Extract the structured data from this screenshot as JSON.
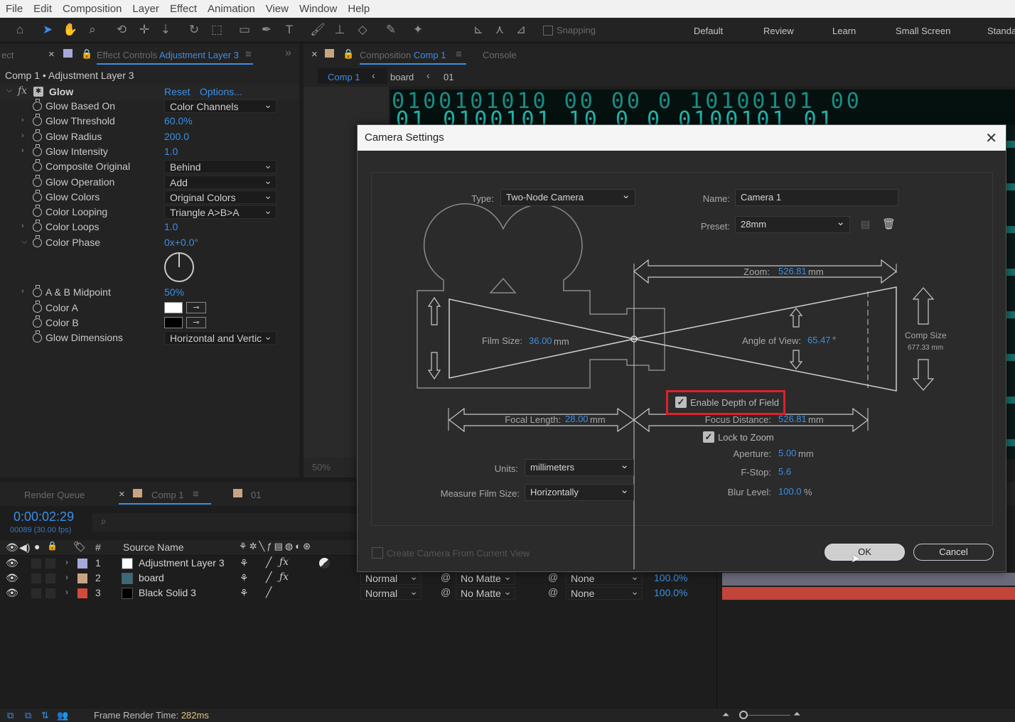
{
  "menu": [
    "File",
    "Edit",
    "Composition",
    "Layer",
    "Effect",
    "Animation",
    "View",
    "Window",
    "Help"
  ],
  "toolbar": {
    "snapping_label": "Snapping",
    "workspaces": [
      "Default",
      "Review",
      "Learn",
      "Small Screen",
      "Standa"
    ]
  },
  "effect_controls": {
    "tab_prefix": "ect",
    "tab_label": "Effect Controls",
    "tab_layer": "Adjustment Layer 3",
    "header": "Comp 1 • Adjustment Layer 3",
    "effect_name": "Glow",
    "reset": "Reset",
    "options": "Options...",
    "rows": [
      {
        "name": "Glow Based On",
        "kind": "dropdown",
        "value": "Color Channels",
        "twirl": false
      },
      {
        "name": "Glow Threshold",
        "kind": "value",
        "value": "60.0%",
        "twirl": true
      },
      {
        "name": "Glow Radius",
        "kind": "value",
        "value": "200.0",
        "twirl": true
      },
      {
        "name": "Glow Intensity",
        "kind": "value",
        "value": "1.0",
        "twirl": true
      },
      {
        "name": "Composite Original",
        "kind": "dropdown",
        "value": "Behind",
        "twirl": false
      },
      {
        "name": "Glow Operation",
        "kind": "dropdown",
        "value": "Add",
        "twirl": false
      },
      {
        "name": "Glow Colors",
        "kind": "dropdown",
        "value": "Original Colors",
        "twirl": false
      },
      {
        "name": "Color Looping",
        "kind": "dropdown",
        "value": "Triangle A>B>A",
        "twirl": false
      },
      {
        "name": "Color Loops",
        "kind": "value",
        "value": "1.0",
        "twirl": true
      },
      {
        "name": "Color Phase",
        "kind": "value",
        "value": "0x+0.0°",
        "twirl": true
      }
    ],
    "rows2": [
      {
        "name": "A & B Midpoint",
        "value": "50%"
      },
      {
        "name": "Color A",
        "value": "#ffffff"
      },
      {
        "name": "Color B",
        "value": "#000000"
      },
      {
        "name": "Glow Dimensions",
        "value": "Horizontal and Vertic"
      }
    ]
  },
  "comp_panel": {
    "tab_label": "Composition",
    "tab_comp": "Comp 1",
    "console": "Console",
    "breadcrumbs": [
      "Comp 1",
      "board",
      "01"
    ],
    "zoom": "50%",
    "matrix_line1": "0100101010 00 00 0 10100101 00",
    "matrix_line2": "01 0100101 10 0 0 0100101 01"
  },
  "timeline": {
    "tabs": [
      "Render Queue",
      "Comp 1",
      "01"
    ],
    "timecode": "0:00:02:29",
    "frames": "00089 (30.00 fps)",
    "source_name_header": "Source Name",
    "hash_header": "#",
    "layers": [
      {
        "num": "1",
        "name": "Adjustment Layer 3",
        "color": "#a6a9d8",
        "thumb": "#ffffff",
        "mode": "",
        "matte": "",
        "parent": "",
        "opacity": ""
      },
      {
        "num": "2",
        "name": "board",
        "color": "#c7a582",
        "thumb": "#3a6a7a",
        "mode": "Normal",
        "matte": "No Matte",
        "parent": "None",
        "opacity": "100.0%"
      },
      {
        "num": "3",
        "name": "Black Solid 3",
        "color": "#d24a3a",
        "thumb": "#000000",
        "mode": "Normal",
        "matte": "No Matte",
        "parent": "None",
        "opacity": "100.0%"
      }
    ]
  },
  "status": {
    "frame_render_label": "Frame Render Time:",
    "frame_render_value": "282ms"
  },
  "dialog": {
    "title": "Camera Settings",
    "type_label": "Type:",
    "type_value": "Two-Node Camera",
    "name_label": "Name:",
    "name_value": "Camera 1",
    "preset_label": "Preset:",
    "preset_value": "28mm",
    "zoom_label": "Zoom:",
    "zoom_value": "526.81",
    "zoom_unit": "mm",
    "film_size_label": "Film Size:",
    "film_size_value": "36.00",
    "film_size_unit": "mm",
    "angle_label": "Angle of View:",
    "angle_value": "65.47",
    "angle_unit": "°",
    "comp_size_label": "Comp Size",
    "comp_size_value": "677.33 mm",
    "enable_dof_label": "Enable Depth of Field",
    "enable_dof_checked": true,
    "focal_label": "Focal Length:",
    "focal_value": "28.00",
    "focal_unit": "mm",
    "focus_label": "Focus Distance:",
    "focus_value": "526.81",
    "focus_unit": "mm",
    "lock_zoom_label": "Lock to Zoom",
    "lock_zoom_checked": true,
    "aperture_label": "Aperture:",
    "aperture_value": "5.00",
    "aperture_unit": "mm",
    "fstop_label": "F-Stop:",
    "fstop_value": "5.6",
    "blur_label": "Blur Level:",
    "blur_value": "100.0",
    "blur_unit": "%",
    "units_label": "Units:",
    "units_value": "millimeters",
    "measure_label": "Measure Film Size:",
    "measure_value": "Horizontally",
    "create_from_view": "Create Camera From Current View",
    "ok": "OK",
    "cancel": "Cancel",
    "highlight_color": "#e0202a"
  }
}
